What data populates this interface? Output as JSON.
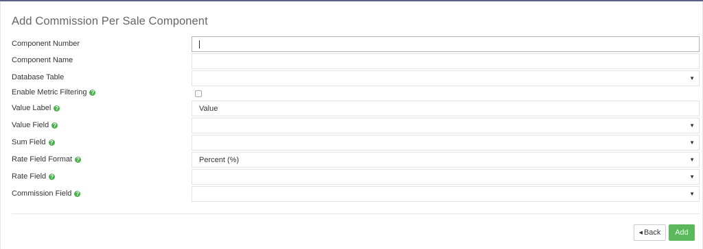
{
  "form": {
    "title": "Add Commission Per Sale Component",
    "fields": [
      {
        "label": "Component Number",
        "value": "",
        "type": "text"
      },
      {
        "label": "Component Name",
        "value": "",
        "type": "text"
      },
      {
        "label": "Database Table",
        "value": "",
        "type": "select"
      },
      {
        "label": "Enable Metric Filtering",
        "type": "checkbox",
        "checked": false,
        "help": true
      },
      {
        "label": "Value Label",
        "value": "Value",
        "type": "text",
        "help": true
      },
      {
        "label": "Value Field",
        "value": "",
        "type": "select",
        "help": true
      },
      {
        "label": "Sum Field",
        "value": "",
        "type": "select",
        "help": true
      },
      {
        "label": "Rate Field Format",
        "value": "Percent (%)",
        "type": "select",
        "help": true
      },
      {
        "label": "Rate Field",
        "value": "",
        "type": "select",
        "help": true
      },
      {
        "label": "Commission Field",
        "value": "",
        "type": "select",
        "help": true
      }
    ],
    "help_glyph": "?",
    "select_arrow": "▼"
  },
  "buttons": {
    "back_label": "Back",
    "back_icon": "◀",
    "add_label": "Add"
  },
  "colors": {
    "accent": "#5cb85c",
    "help": "#4caf50",
    "top_border": "#5b5f8a"
  }
}
